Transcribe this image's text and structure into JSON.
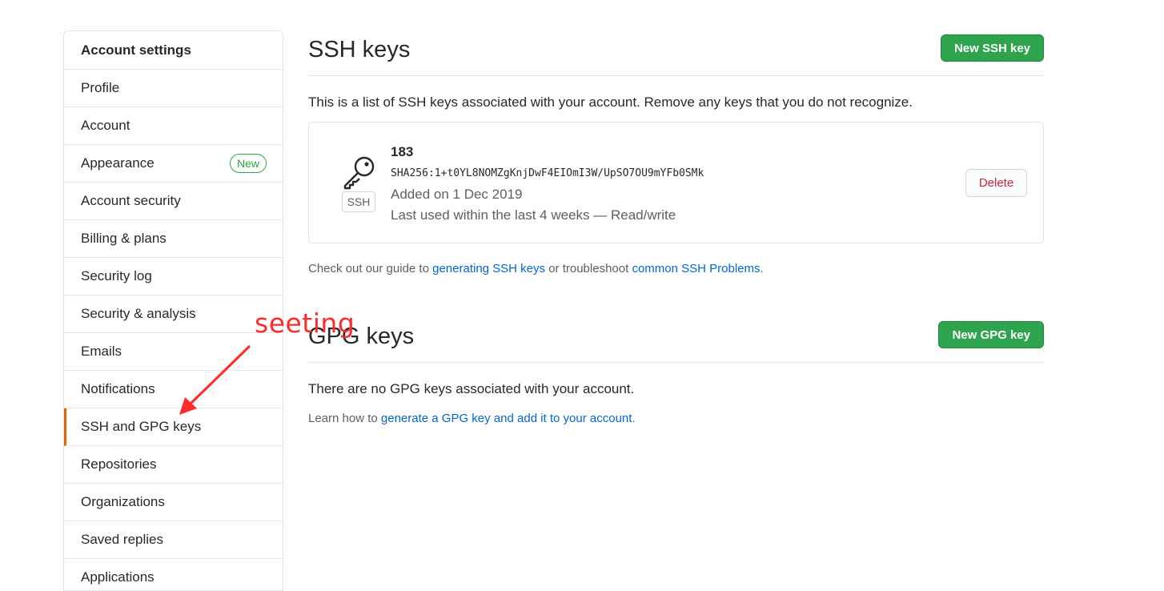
{
  "sidebar": {
    "header": "Account settings",
    "items": [
      {
        "label": "Profile"
      },
      {
        "label": "Account"
      },
      {
        "label": "Appearance",
        "badge": "New"
      },
      {
        "label": "Account security"
      },
      {
        "label": "Billing & plans"
      },
      {
        "label": "Security log"
      },
      {
        "label": "Security & analysis"
      },
      {
        "label": "Emails"
      },
      {
        "label": "Notifications"
      },
      {
        "label": "SSH and GPG keys",
        "selected": true
      },
      {
        "label": "Repositories"
      },
      {
        "label": "Organizations"
      },
      {
        "label": "Saved replies"
      },
      {
        "label": "Applications"
      }
    ]
  },
  "ssh": {
    "title": "SSH keys",
    "new_button": "New SSH key",
    "description": "This is a list of SSH keys associated with your account. Remove any keys that you do not recognize.",
    "key": {
      "icon": "key-icon",
      "type_label": "SSH",
      "title": "183",
      "fingerprint": "SHA256:1+t0YL8NOMZgKnjDwF4EIOmI3W/UpSO7OU9mYFb0SMk",
      "added": "Added on 1 Dec 2019",
      "last_used": "Last used within the last 4 weeks — Read/write",
      "delete_button": "Delete"
    },
    "guide": {
      "prefix": "Check out our guide to ",
      "link1": "generating SSH keys",
      "middle": " or troubleshoot ",
      "link2": "common SSH Problems",
      "suffix": "."
    }
  },
  "gpg": {
    "title": "GPG keys",
    "new_button": "New GPG key",
    "empty": "There are no GPG keys associated with your account.",
    "learn": {
      "prefix": "Learn how to ",
      "link": "generate a GPG key and add it to your account",
      "suffix": "."
    }
  },
  "annotation": {
    "text": "seeting",
    "color": "#ff2a2a"
  },
  "colors": {
    "accent_green": "#2ea44f",
    "selected_border": "#e36209",
    "link": "#0366d6",
    "danger": "#cb2431"
  }
}
